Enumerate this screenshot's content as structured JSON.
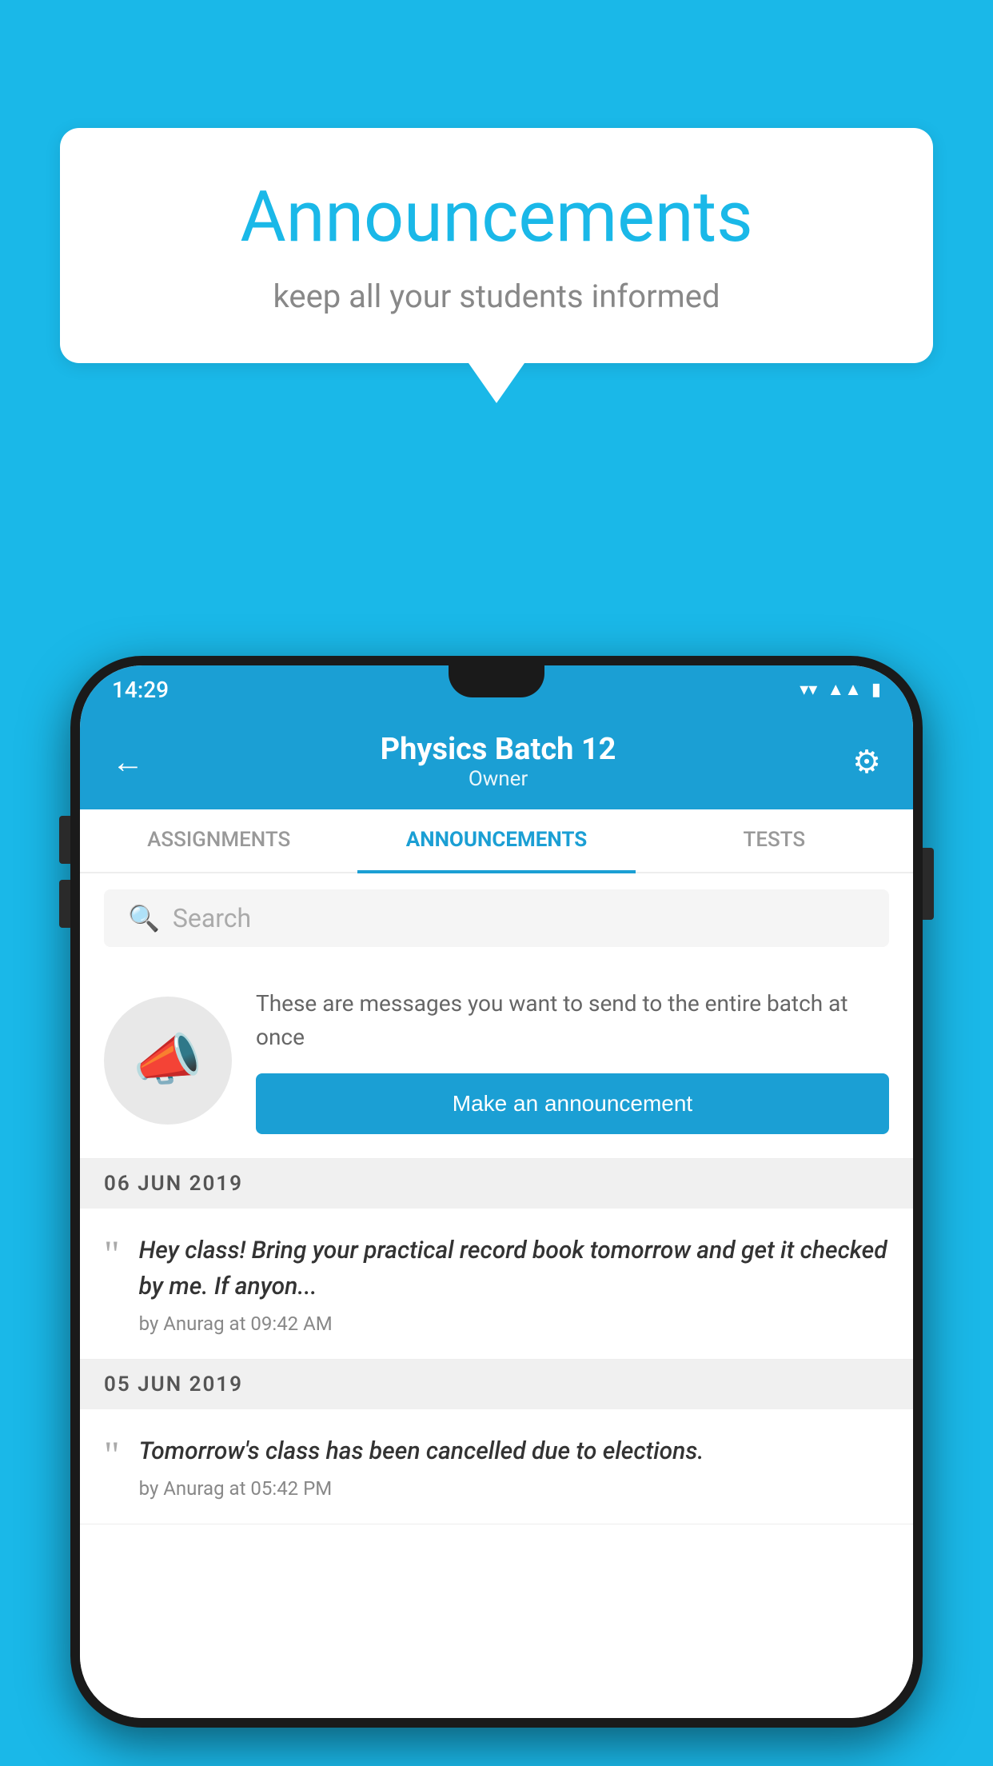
{
  "page": {
    "background_color": "#1ab8e8"
  },
  "speech_bubble": {
    "title": "Announcements",
    "subtitle": "keep all your students informed"
  },
  "phone": {
    "status_bar": {
      "time": "14:29",
      "icons": [
        "wifi",
        "signal",
        "battery"
      ]
    },
    "header": {
      "title": "Physics Batch 12",
      "subtitle": "Owner",
      "back_label": "←",
      "settings_label": "⚙"
    },
    "tabs": [
      {
        "label": "ASSIGNMENTS",
        "active": false
      },
      {
        "label": "ANNOUNCEMENTS",
        "active": true
      },
      {
        "label": "TESTS",
        "active": false
      }
    ],
    "search": {
      "placeholder": "Search"
    },
    "promo": {
      "description": "These are messages you want to send to the entire batch at once",
      "button_label": "Make an announcement"
    },
    "announcements": [
      {
        "date": "06  JUN  2019",
        "text": "Hey class! Bring your practical record book tomorrow and get it checked by me. If anyon...",
        "meta": "by Anurag at 09:42 AM"
      },
      {
        "date": "05  JUN  2019",
        "text": "Tomorrow's class has been cancelled due to elections.",
        "meta": "by Anurag at 05:42 PM"
      }
    ]
  }
}
